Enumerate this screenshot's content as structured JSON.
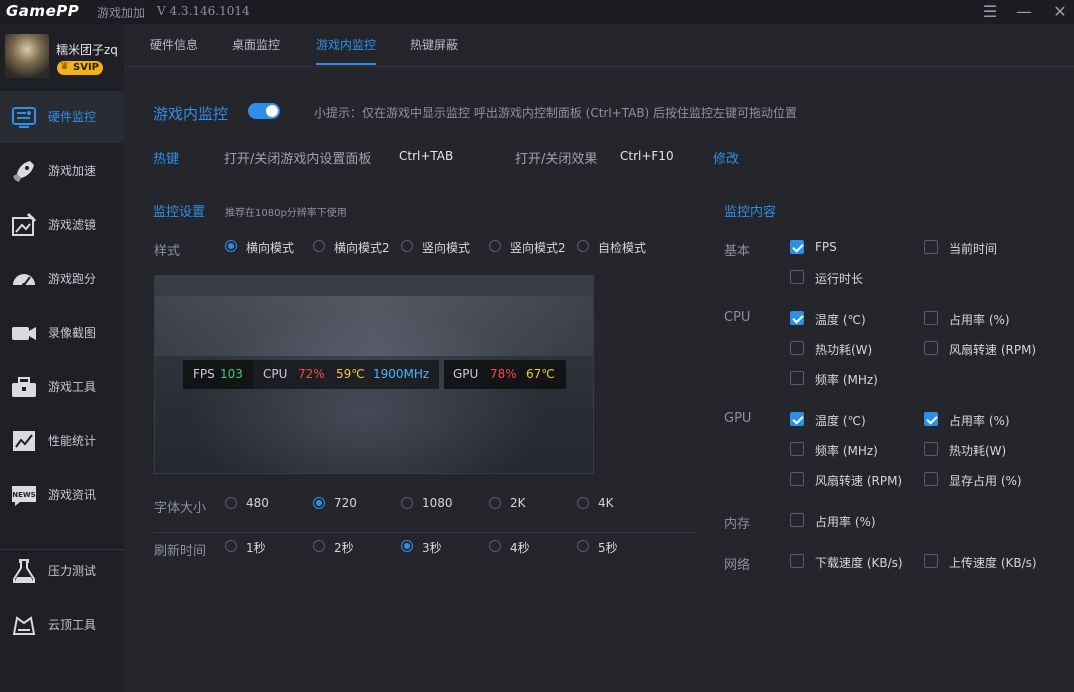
{
  "titlebar": {
    "logo_game": "Game",
    "logo_pp": "PP",
    "app_name": "游戏加加",
    "version": "V 4.3.146.1014",
    "menu_icon": "menu-icon",
    "minimize_icon": "minimize-icon",
    "close_icon": "close-icon"
  },
  "user": {
    "name": "糯米团子zq",
    "badge": "SVIP"
  },
  "sidebar": {
    "items": [
      {
        "label": "硬件监控",
        "icon": "hardware-monitor-icon",
        "active": true
      },
      {
        "label": "游戏加速",
        "icon": "rocket-icon"
      },
      {
        "label": "游戏滤镜",
        "icon": "filter-icon"
      },
      {
        "label": "游戏跑分",
        "icon": "speedometer-icon"
      },
      {
        "label": "录像截图",
        "icon": "video-camera-icon"
      },
      {
        "label": "游戏工具",
        "icon": "toolbox-icon"
      },
      {
        "label": "性能统计",
        "icon": "chart-icon"
      },
      {
        "label": "游戏资讯",
        "icon": "news-icon"
      },
      {
        "label": "压力测试",
        "icon": "flask-icon"
      },
      {
        "label": "云顶工具",
        "icon": "crown-icon"
      }
    ]
  },
  "tabs": [
    {
      "label": "硬件信息"
    },
    {
      "label": "桌面监控"
    },
    {
      "label": "游戏内监控",
      "active": true
    },
    {
      "label": "热键屏蔽"
    }
  ],
  "ingame": {
    "title": "游戏内监控",
    "enabled": true,
    "hint": "小提示：仅在游戏中显示监控 呼出游戏内控制面板 (Ctrl+TAB) 后按住监控左键可拖动位置"
  },
  "hotkeys": {
    "label": "热键",
    "panel_text": "打开/关闭游戏内设置面板",
    "panel_key": "Ctrl+TAB",
    "effect_text": "打开/关闭效果",
    "effect_key": "Ctrl+F10",
    "modify": "修改"
  },
  "monitor_settings": {
    "title": "监控设置",
    "subtitle": "推荐在1080p分辨率下使用",
    "style_label": "样式",
    "styles": [
      "横向模式",
      "横向模式2",
      "竖向模式",
      "竖向模式2",
      "自检模式"
    ],
    "style_selected": 0,
    "font_label": "字体大小",
    "fonts": [
      "480",
      "720",
      "1080",
      "2K",
      "4K"
    ],
    "font_selected": 1,
    "refresh_label": "刷新时间",
    "refresh": [
      "1秒",
      "2秒",
      "3秒",
      "4秒",
      "5秒"
    ],
    "refresh_selected": 2
  },
  "preview": {
    "fps_label": "FPS",
    "fps": "103",
    "cpu_label": "CPU",
    "cpu_usage": "72%",
    "cpu_temp": "59℃",
    "cpu_freq": "1900MHz",
    "gpu_label": "GPU",
    "gpu_usage": "78%",
    "gpu_temp": "67℃",
    "colors": {
      "green": "#3ad06e",
      "red": "#f04b4b",
      "yellow": "#e9c93a",
      "cyan": "#4fb3ff"
    }
  },
  "monitor_content": {
    "title": "监控内容",
    "groups": [
      {
        "label": "基本",
        "items": [
          {
            "label": "FPS",
            "checked": true
          },
          {
            "label": "当前时间",
            "checked": false
          },
          {
            "label": "运行时长",
            "checked": false
          }
        ]
      },
      {
        "label": "CPU",
        "items": [
          {
            "label": "温度 (℃)",
            "checked": true
          },
          {
            "label": "占用率 (%)",
            "checked": false
          },
          {
            "label": "热功耗(W)",
            "checked": false
          },
          {
            "label": "风扇转速 (RPM)",
            "checked": false
          },
          {
            "label": "频率 (MHz)",
            "checked": false
          }
        ]
      },
      {
        "label": "GPU",
        "items": [
          {
            "label": "温度 (℃)",
            "checked": true
          },
          {
            "label": "占用率 (%)",
            "checked": true
          },
          {
            "label": "频率 (MHz)",
            "checked": false
          },
          {
            "label": "热功耗(W)",
            "checked": false
          },
          {
            "label": "风扇转速 (RPM)",
            "checked": false
          },
          {
            "label": "显存占用 (%)",
            "checked": false
          }
        ]
      },
      {
        "label": "内存",
        "items": [
          {
            "label": "占用率 (%)",
            "checked": false
          }
        ]
      },
      {
        "label": "网络",
        "items": [
          {
            "label": "下载速度 (KB/s)",
            "checked": false
          },
          {
            "label": "上传速度 (KB/s)",
            "checked": false
          }
        ]
      }
    ]
  },
  "accent_color": "#2e8fe8"
}
